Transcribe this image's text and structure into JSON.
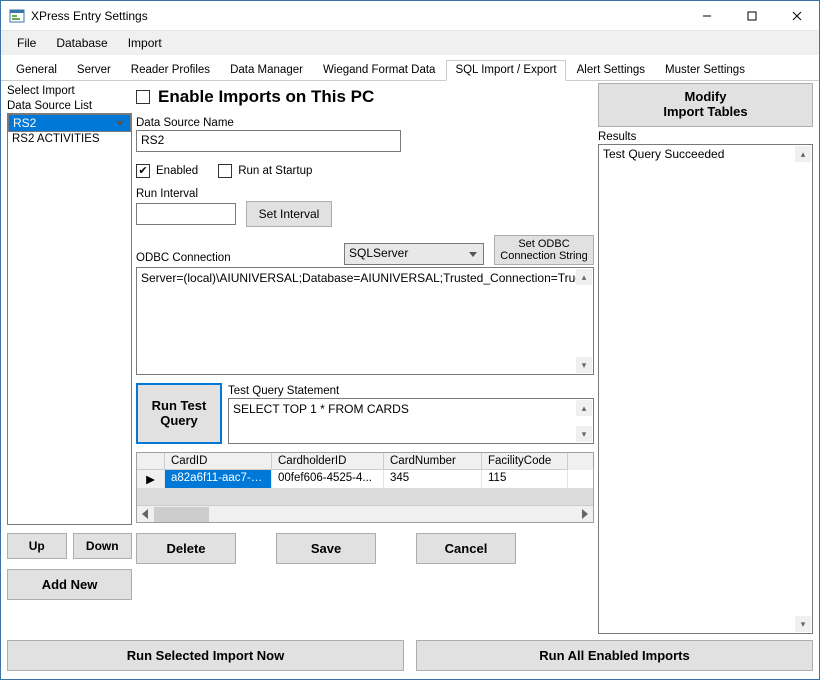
{
  "window": {
    "title": "XPress Entry Settings"
  },
  "menu": {
    "items": [
      "File",
      "Database",
      "Import"
    ]
  },
  "tabs": {
    "items": [
      "General",
      "Server",
      "Reader Profiles",
      "Data Manager",
      "Wiegand Format Data",
      "SQL Import / Export",
      "Alert Settings",
      "Muster Settings"
    ],
    "active_index": 5
  },
  "left": {
    "select_import_label": "Select Import",
    "data_source_list_label": "Data Source List",
    "items": [
      "RS2",
      "RS2 ACTIVITIES"
    ],
    "selected_index": 0,
    "up_label": "Up",
    "down_label": "Down",
    "add_new_label": "Add New"
  },
  "mid": {
    "enable_imports_label": "Enable Imports on This PC",
    "enable_imports_checked": false,
    "data_source_name_label": "Data Source Name",
    "data_source_name_value": "RS2",
    "enabled_label": "Enabled",
    "enabled_checked": true,
    "run_startup_label": "Run at Startup",
    "run_startup_checked": false,
    "run_interval_label": "Run Interval",
    "run_interval_value": "",
    "set_interval_label": "Set Interval",
    "odbc_label": "ODBC Connection",
    "odbc_driver": "SQLServer",
    "set_odbc_label1": "Set ODBC",
    "set_odbc_label2": "Connection String",
    "conn_string": "Server=(local)\\AIUNIVERSAL;Database=AIUNIVERSAL;Trusted_Connection=True;",
    "run_test_label1": "Run Test",
    "run_test_label2": "Query",
    "test_query_label": "Test Query Statement",
    "test_query_value": "SELECT TOP 1 * FROM CARDS",
    "table": {
      "columns": [
        "",
        "CardID",
        "CardholderID",
        "CardNumber",
        "FacilityCode"
      ],
      "rows": [
        {
          "marker": "▶",
          "CardID": "a82a6f11-aac7-4...",
          "CardholderID": "00fef606-4525-4...",
          "CardNumber": "345",
          "FacilityCode": "115"
        }
      ]
    },
    "delete_label": "Delete",
    "save_label": "Save",
    "cancel_label": "Cancel"
  },
  "right": {
    "modify_label1": "Modify",
    "modify_label2": "Import Tables",
    "results_label": "Results",
    "results_text": "Test Query Succeeded"
  },
  "bottom": {
    "run_selected_label": "Run Selected Import Now",
    "run_all_label": "Run All Enabled Imports"
  }
}
